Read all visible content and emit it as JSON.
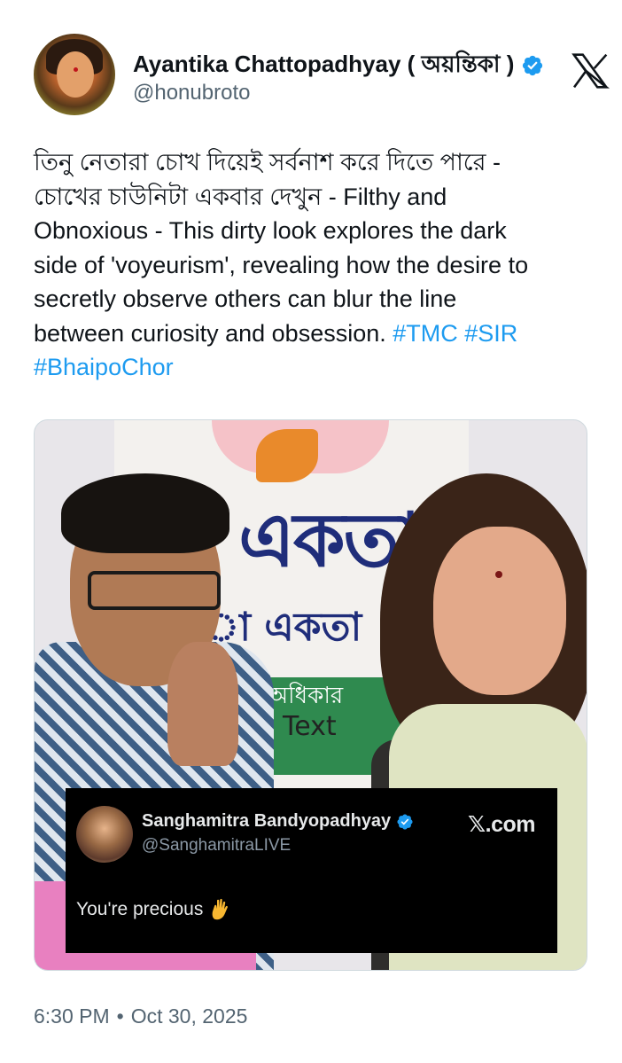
{
  "author": {
    "name": "Ayantika Chattopadhyay ( অয়ন্তিকা )",
    "handle": "@honubroto"
  },
  "tweet": {
    "text_lines": [
      "তিনু নেতারা চোখ দিয়েই সর্বনাশ করে দিতে পারে -",
      "চোখের চাউনিটা একবার দেখুন - Filthy and",
      "Obnoxious - This dirty look explores the dark",
      "side of 'voyeurism', revealing how the desire to",
      "secretly observe others can blur the line",
      "between curiosity and obsession. "
    ],
    "hashtags": [
      "#TMC",
      "#SIR",
      "#BhaipoChor"
    ]
  },
  "media": {
    "banner_word": "একতা",
    "banner_word2": "া একতা",
    "banner_word3": "• অধিকার",
    "overlay_text": "Text",
    "quote": {
      "name": "Sanghamitra Bandyopadhyay",
      "handle": "@SanghamitraLIVE",
      "brand": "𝕏.com",
      "text": "You're precious"
    }
  },
  "meta": {
    "time": "6:30 PM",
    "separator": "•",
    "date": "Oct 30, 2025"
  },
  "colors": {
    "verified": "#1d9bf0",
    "hashtag": "#1d9bf0",
    "secondary_text": "#536471"
  },
  "icons": [
    "verified-badge-icon",
    "x-logo-icon",
    "pinched-fingers-emoji"
  ]
}
